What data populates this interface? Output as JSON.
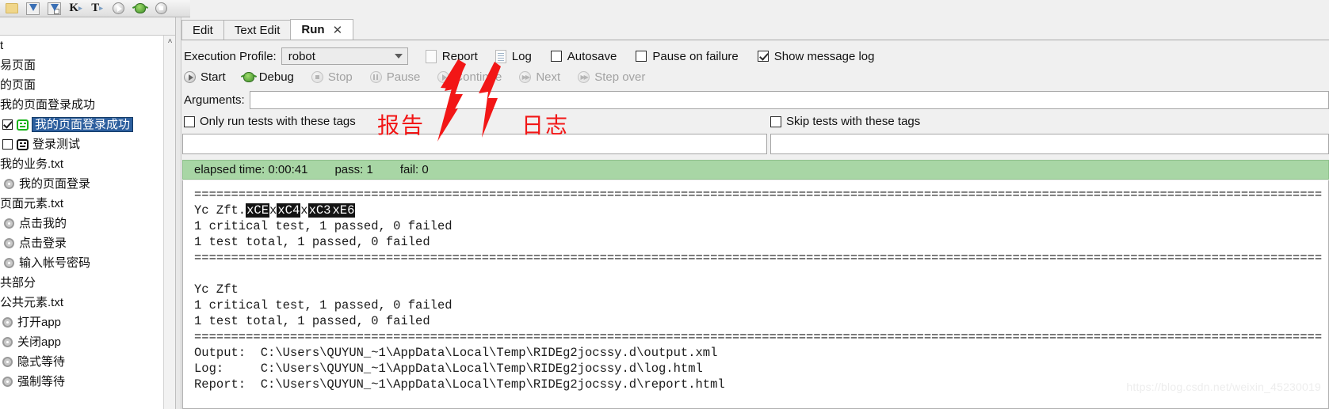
{
  "toolbar": {
    "icons": [
      {
        "name": "open-folder-icon",
        "glyph": "folder"
      },
      {
        "name": "save-icon",
        "glyph": "save"
      },
      {
        "name": "save-all-icon",
        "glyph": "save-all"
      },
      {
        "name": "search-keyword-icon",
        "label": "K"
      },
      {
        "name": "search-tag-icon",
        "label": "T"
      },
      {
        "name": "start-icon",
        "glyph": "play"
      },
      {
        "name": "debug-icon",
        "glyph": "bug"
      },
      {
        "name": "stop-icon",
        "glyph": "stop"
      }
    ]
  },
  "sidebar": {
    "items": [
      {
        "label": "t",
        "type": "text",
        "indent": 0
      },
      {
        "label": "易页面",
        "type": "text",
        "indent": 0
      },
      {
        "label": "的页面",
        "type": "text",
        "indent": 0
      },
      {
        "label": "我的页面登录成功",
        "type": "text",
        "indent": 0
      },
      {
        "label": "我的页面登录成功",
        "type": "test",
        "checked": true,
        "selected": true,
        "face": "green",
        "indent": 1
      },
      {
        "label": "登录测试",
        "type": "test",
        "checked": false,
        "selected": false,
        "face": "black",
        "indent": 1
      },
      {
        "label": "我的业务.txt",
        "type": "text",
        "indent": 0
      },
      {
        "label": "我的页面登录",
        "type": "keyword",
        "indent": 1
      },
      {
        "label": "页面元素.txt",
        "type": "text",
        "indent": 0
      },
      {
        "label": "点击我的",
        "type": "keyword",
        "indent": 1
      },
      {
        "label": "点击登录",
        "type": "keyword",
        "indent": 1
      },
      {
        "label": "输入帐号密码",
        "type": "keyword",
        "indent": 1
      },
      {
        "label": "共部分",
        "type": "text",
        "indent": 0
      },
      {
        "label": "公共元素.txt",
        "type": "text",
        "indent": 0
      },
      {
        "label": "打开app",
        "type": "keyword",
        "indent": 1
      },
      {
        "label": "关闭app",
        "type": "keyword",
        "indent": 1
      },
      {
        "label": "隐式等待",
        "type": "keyword",
        "indent": 1
      },
      {
        "label": "强制等待",
        "type": "keyword",
        "indent": 1
      }
    ],
    "scroll_up_glyph": "˄"
  },
  "tabs": [
    {
      "label": "Edit",
      "active": false,
      "closable": false
    },
    {
      "label": "Text Edit",
      "active": false,
      "closable": false
    },
    {
      "label": "Run",
      "active": true,
      "closable": true,
      "close_glyph": "✕"
    }
  ],
  "exec_row": {
    "profile_label": "Execution Profile:",
    "profile_value": "robot",
    "report_label": "Report",
    "log_label": "Log",
    "autosave_label": "Autosave",
    "autosave_checked": false,
    "pause_on_failure_label": "Pause on failure",
    "pause_on_failure_checked": false,
    "show_message_log_label": "Show message log",
    "show_message_log_checked": true
  },
  "run_row": {
    "buttons": [
      {
        "label": "Start",
        "enabled": true,
        "icon": "play-circle-icon"
      },
      {
        "label": "Debug",
        "enabled": true,
        "icon": "bug-icon"
      },
      {
        "label": "Stop",
        "enabled": false,
        "icon": "stop-circle-icon"
      },
      {
        "label": "Pause",
        "enabled": false,
        "icon": "pause-circle-icon"
      },
      {
        "label": "Continue",
        "enabled": false,
        "icon": "play-circle-icon"
      },
      {
        "label": "Next",
        "enabled": false,
        "icon": "next-circle-icon"
      },
      {
        "label": "Step over",
        "enabled": false,
        "icon": "step-over-circle-icon"
      }
    ]
  },
  "arguments": {
    "label": "Arguments:",
    "value": "",
    "placeholder": ""
  },
  "tags": {
    "only_run_label": "Only run tests with these tags",
    "only_run_checked": false,
    "skip_label": "Skip tests with these tags",
    "skip_checked": false,
    "only_run_value": "",
    "skip_value": ""
  },
  "status": {
    "elapsed": "elapsed time: 0:00:41",
    "pass": "pass: 1",
    "fail": "fail: 0",
    "bg_color": "#a8d6a5"
  },
  "console": {
    "lines": [
      {
        "text": "=========================================================================================================================================================",
        "type": "rule"
      },
      {
        "text": "Yc Zft.",
        "type": "garbled",
        "tokens": [
          "xCE",
          "x",
          "xC4",
          "x",
          "xC3",
          "xE6"
        ]
      },
      {
        "text": "1 critical test, 1 passed, 0 failed",
        "type": "plain"
      },
      {
        "text": "1 test total, 1 passed, 0 failed",
        "type": "plain"
      },
      {
        "text": "=========================================================================================================================================================",
        "type": "rule"
      },
      {
        "text": "",
        "type": "blank"
      },
      {
        "text": "Yc Zft",
        "type": "plain"
      },
      {
        "text": "1 critical test, 1 passed, 0 failed",
        "type": "plain"
      },
      {
        "text": "1 test total, 1 passed, 0 failed",
        "type": "plain"
      },
      {
        "text": "=========================================================================================================================================================",
        "type": "rule"
      },
      {
        "text": "Output:  C:\\Users\\QUYUN_~1\\AppData\\Local\\Temp\\RIDEg2jocssy.d\\output.xml",
        "type": "plain"
      },
      {
        "text": "Log:     C:\\Users\\QUYUN_~1\\AppData\\Local\\Temp\\RIDEg2jocssy.d\\log.html",
        "type": "plain"
      },
      {
        "text": "Report:  C:\\Users\\QUYUN_~1\\AppData\\Local\\Temp\\RIDEg2jocssy.d\\report.html",
        "type": "plain"
      }
    ]
  },
  "annotations": {
    "report_label": "报告",
    "log_label": "日志",
    "arrow_color": "#f21616"
  },
  "watermark": {
    "text": "https://blog.csdn.net/weixin_45230019"
  }
}
